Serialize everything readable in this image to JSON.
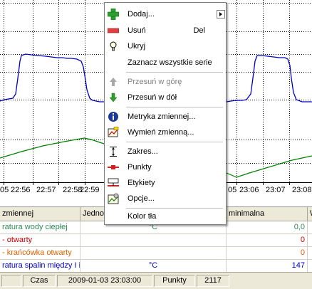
{
  "chart": {
    "x_tick_labels_left": [
      "05",
      "22:56",
      "22:57",
      "22:58",
      "22:59"
    ],
    "x_tick_labels_right": [
      "05",
      "23:06",
      "23:07",
      "23:08"
    ],
    "series_colors": {
      "blue": "#0000c0",
      "green": "#008000"
    }
  },
  "context_menu": {
    "items": [
      {
        "label": "Dodaj...",
        "icon": "plus-icon",
        "submenu": true
      },
      {
        "label": "Usuń",
        "shortcut": "Del",
        "icon": "minus-icon"
      },
      {
        "label": "Ukryj",
        "icon": "lightbulb-icon"
      },
      {
        "label": "Zaznacz wszystkie serie",
        "icon": ""
      },
      {
        "label": "Przesuń w górę",
        "icon": "arrow-up-icon",
        "disabled": true
      },
      {
        "label": "Przesuń w dół",
        "icon": "arrow-down-icon"
      },
      {
        "label": "Metryka zmiennej...",
        "icon": "info-icon"
      },
      {
        "label": "Wymień zmienną...",
        "icon": "replace-icon"
      },
      {
        "label": "Zakres...",
        "icon": "range-icon"
      },
      {
        "label": "Punkty",
        "icon": "points-icon"
      },
      {
        "label": "Etykiety",
        "icon": "labels-icon"
      },
      {
        "label": "Opcje...",
        "icon": "options-icon"
      },
      {
        "label": "Kolor tła",
        "icon": ""
      }
    ]
  },
  "grid": {
    "headers": [
      "zmiennej",
      "Jednos",
      "minimalna",
      "W"
    ],
    "rows": [
      {
        "name": "ratura wody ciepłej",
        "unit": "°C",
        "min": "0,0",
        "color": "#2e8b57",
        "min_color": "#2e8b57"
      },
      {
        "name": "- otwarty",
        "unit": "",
        "min": "0",
        "color": "#cc0000",
        "min_color": "#cc0000"
      },
      {
        "name": "- krańcówka otwarty",
        "unit": "",
        "min": "0",
        "color": "#e06000",
        "min_color": "#e06000"
      },
      {
        "name": "ratura spalin między I i",
        "unit": "°C",
        "min": "147",
        "color": "#0000c0",
        "min_color": "#0000c0"
      }
    ]
  },
  "statusbar": {
    "label_czas": "Czas",
    "datetime": "2009-01-03 23:03:00",
    "label_punkty": "Punkty",
    "points": "2117"
  }
}
